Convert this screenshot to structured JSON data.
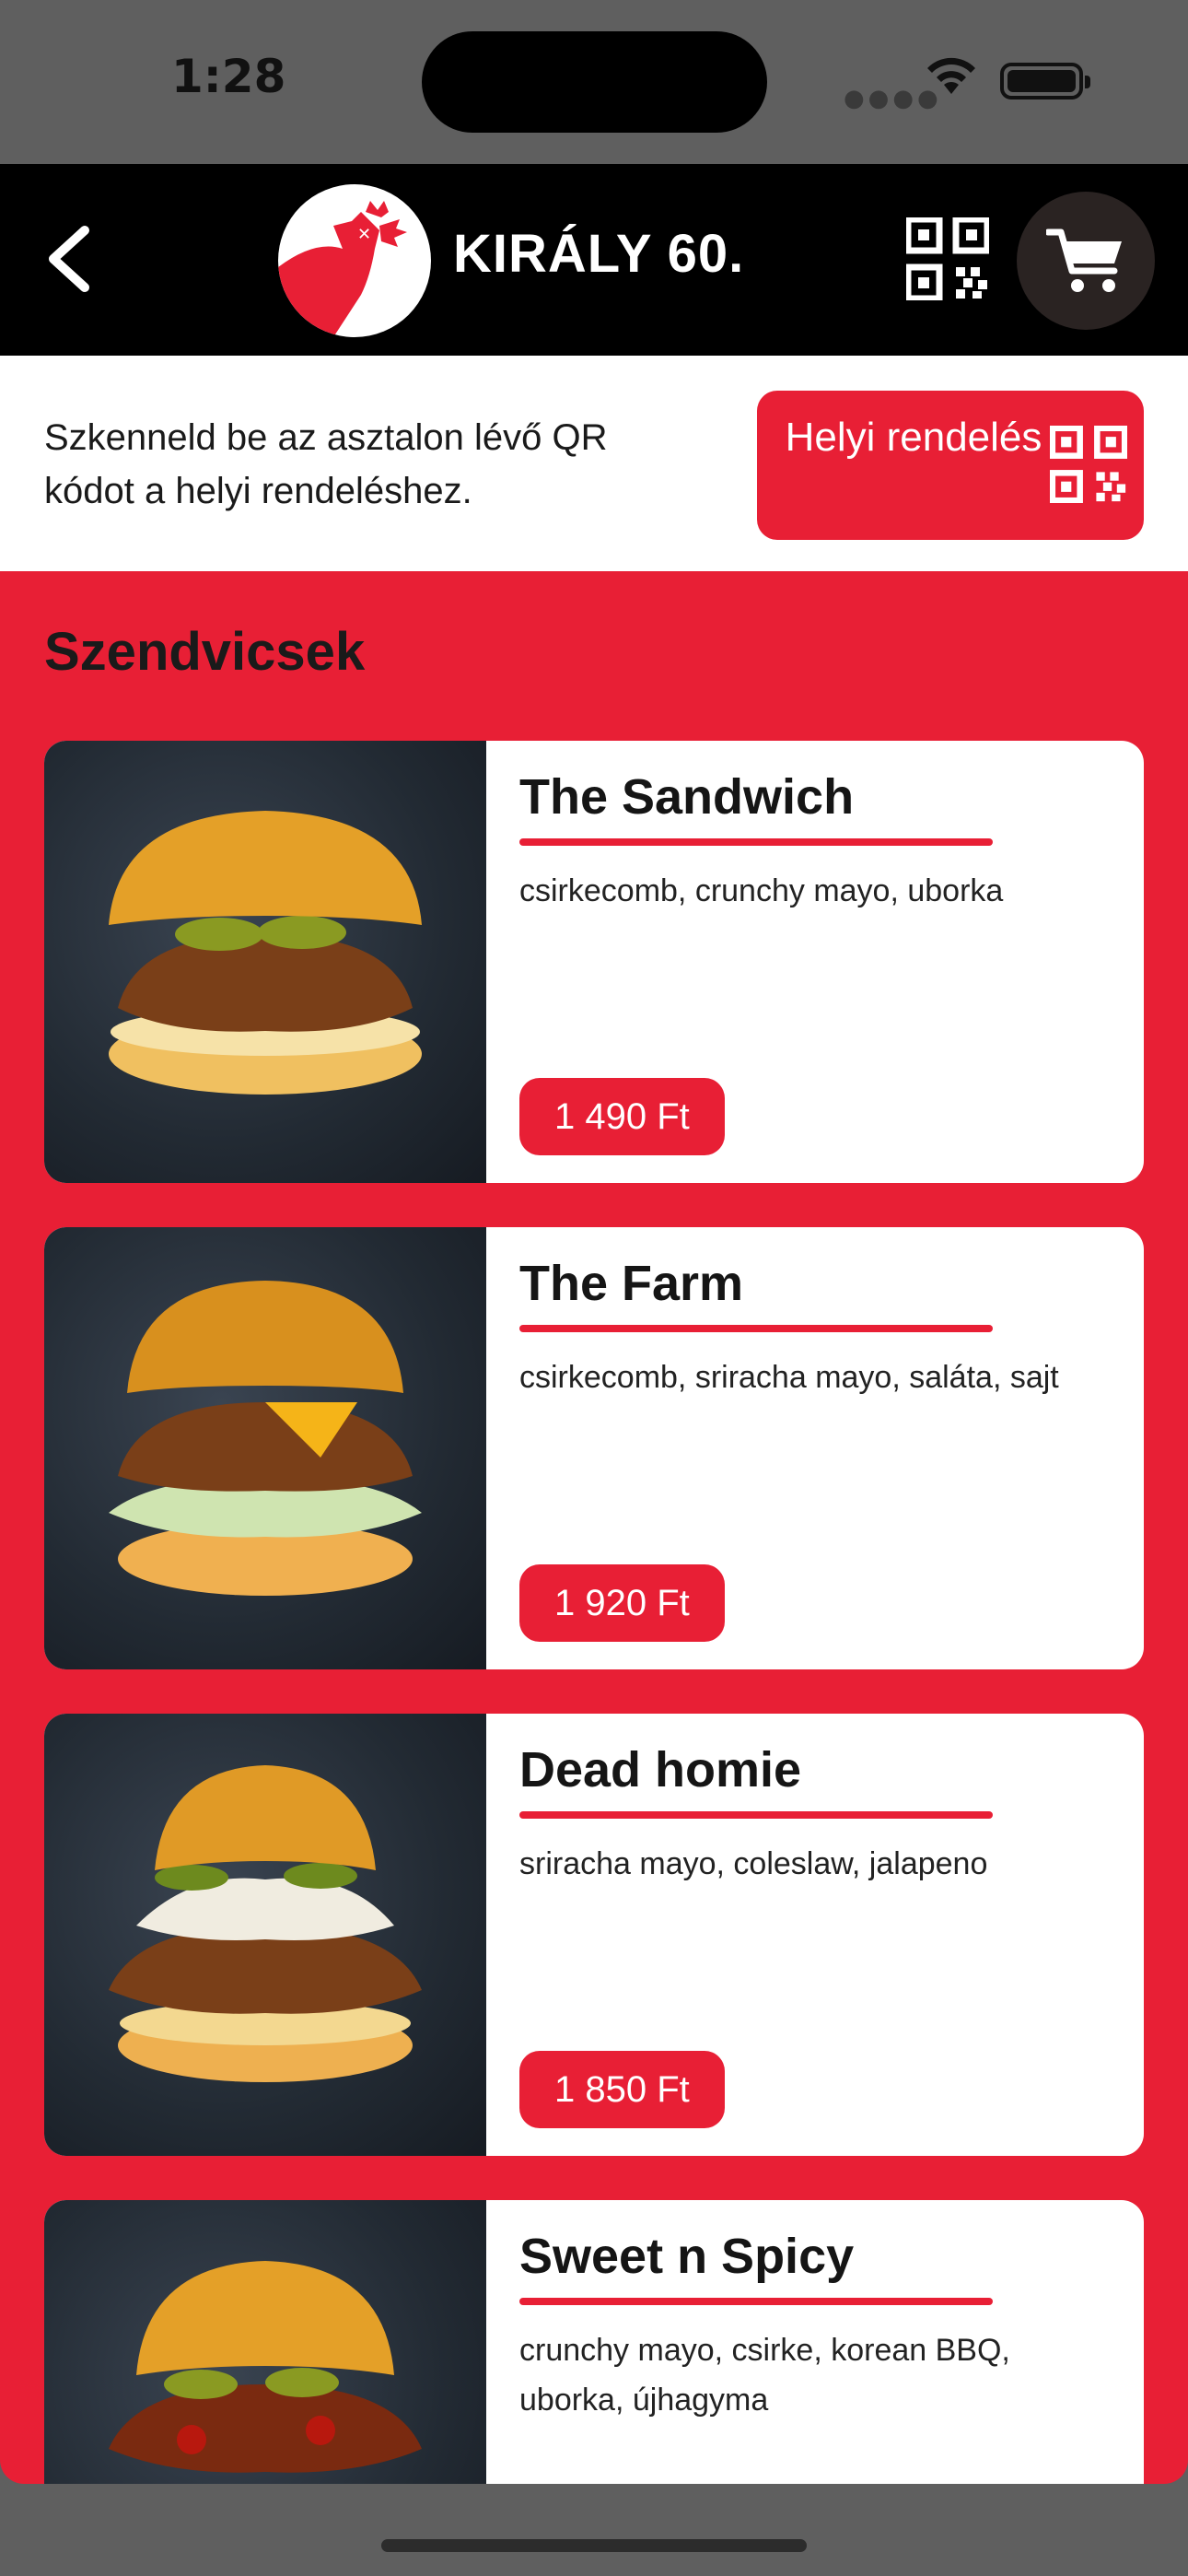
{
  "status_bar": {
    "time": "1:28"
  },
  "header": {
    "title": "KIRÁLY 60.",
    "back_icon": "chevron-left-icon",
    "qr_icon": "qr-code-icon",
    "cart_icon": "cart-icon"
  },
  "notice": {
    "text": "Szkenneld be az asztalon lévő QR kódot a helyi rendeléshez.",
    "button_label": "Helyi rendelés"
  },
  "menu": {
    "section_title": "Szendvicsek",
    "items": [
      {
        "name": "The Sandwich",
        "description": "csirkecomb, crunchy mayo, uborka",
        "price": "1 490 Ft"
      },
      {
        "name": "The Farm",
        "description": "csirkecomb, sriracha mayo, saláta, sajt",
        "price": "1 920 Ft"
      },
      {
        "name": "Dead homie",
        "description": "sriracha mayo, coleslaw, jalapeno",
        "price": "1 850 Ft"
      },
      {
        "name": "Sweet n Spicy",
        "description": "crunchy mayo, csirke, korean BBQ, uborka, újhagyma",
        "price": ""
      }
    ]
  },
  "colors": {
    "accent": "#e81f35",
    "header_bg": "#000000",
    "status_bg": "#5f5f5f"
  }
}
